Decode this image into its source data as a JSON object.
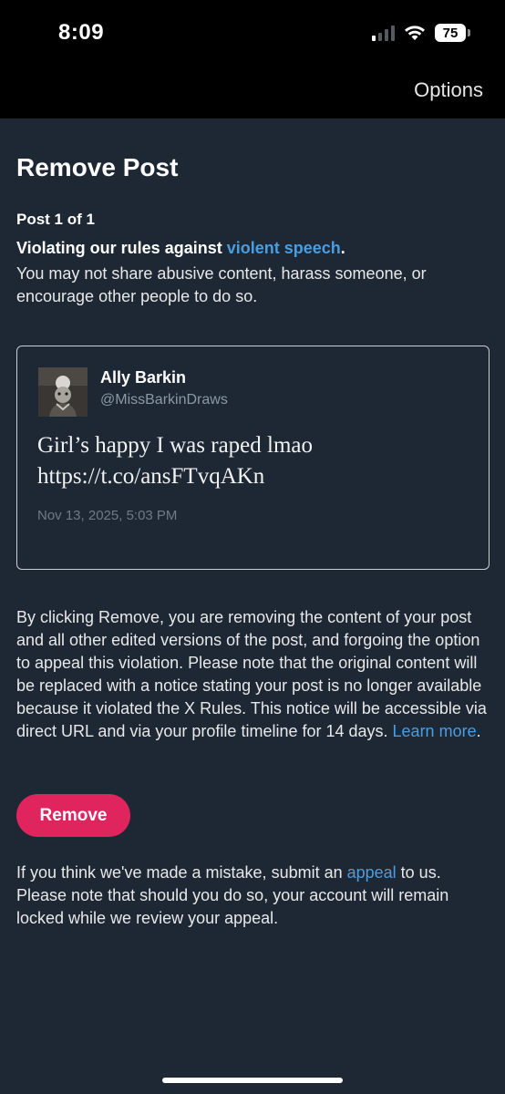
{
  "status_bar": {
    "time": "8:09",
    "battery_level": "75",
    "signal_bars_active": 1,
    "signal_bars_total": 4
  },
  "nav": {
    "options_label": "Options"
  },
  "page": {
    "title": "Remove Post",
    "post_count": "Post 1 of 1",
    "violation_prefix": "Violating our rules against ",
    "violation_rule": "violent speech",
    "violation_suffix": ".",
    "violation_description": "You may not share abusive content, harass someone, or encourage other people to do so."
  },
  "post": {
    "author_name": "Ally Barkin",
    "author_handle": "@MissBarkinDraws",
    "text_line1": "Girl’s happy I was raped lmao",
    "text_line2": "https://t.co/ansFTvqAKn",
    "date": "Nov 13, 2025, 5:03 PM"
  },
  "notice": {
    "body": "By clicking Remove, you are removing the content of your post and all other edited versions of the post, and forgoing the option to appeal this violation. Please note that the original content will be replaced with a notice stating your post is no longer available because it violated the X Rules. This notice will be accessible via direct URL and via your profile timeline for 14 days. ",
    "learn_more_label": "Learn more",
    "end": "."
  },
  "remove_button_label": "Remove",
  "appeal": {
    "prefix": "If you think we've made a mistake, submit an ",
    "link_label": "appeal",
    "suffix": " to us. Please note that should you do so, your account will remain locked while we review your appeal."
  },
  "colors": {
    "background": "#1e2835",
    "link": "#4a9de0",
    "remove_button": "#e0245e"
  }
}
